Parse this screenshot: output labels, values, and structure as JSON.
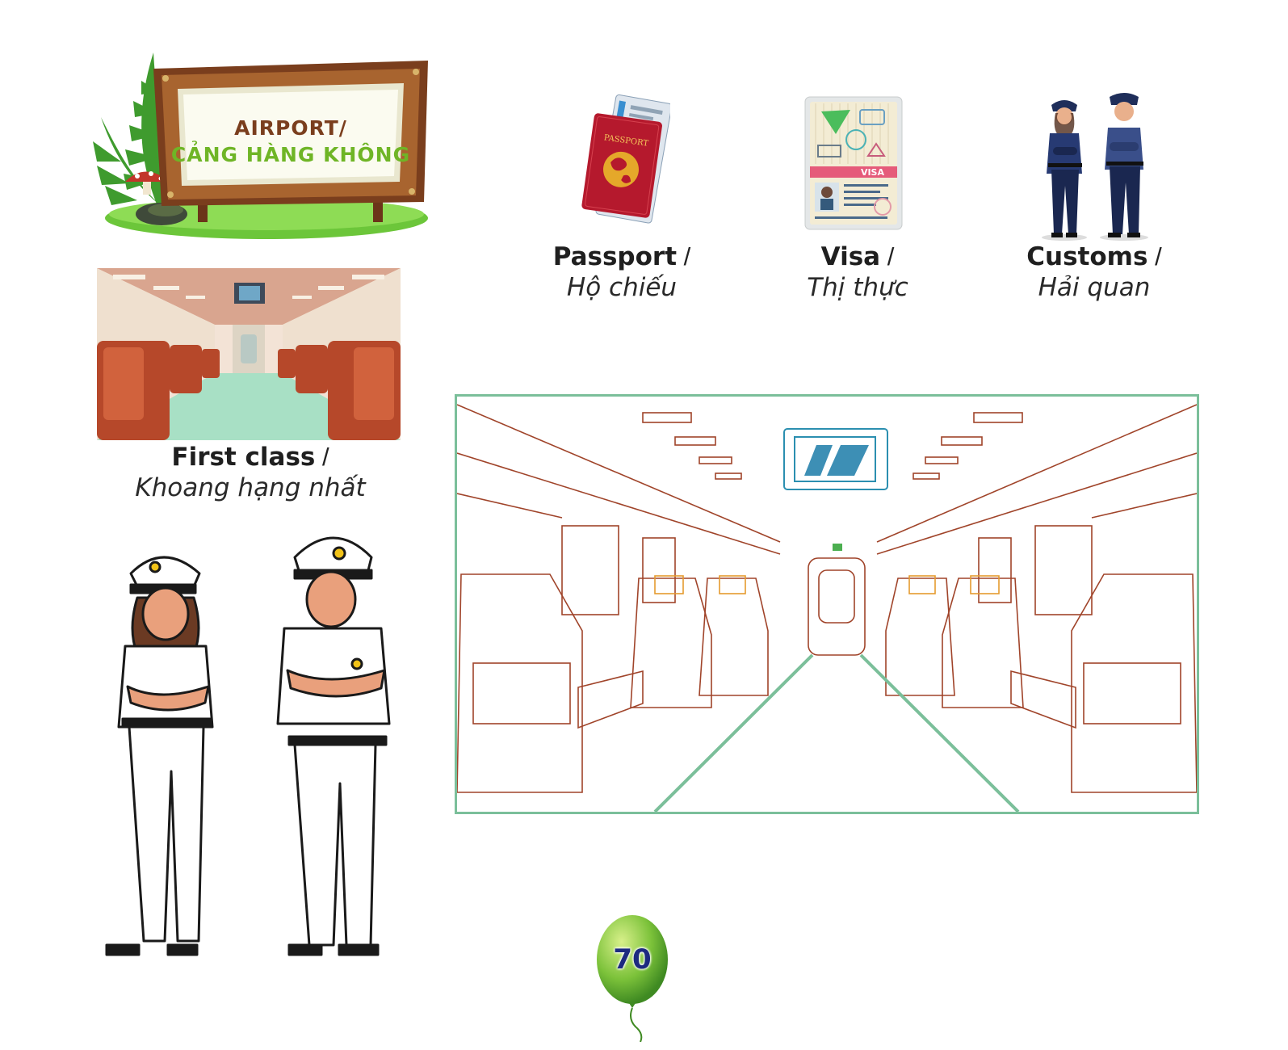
{
  "sign": {
    "line1": "AIRPORT/",
    "line2": "CẢNG HÀNG KHÔNG"
  },
  "vocab": {
    "passport": {
      "en": "Passport",
      "vi": "Hộ chiếu"
    },
    "visa": {
      "en": "Visa",
      "vi": "Thị thực",
      "card_label": "VISA"
    },
    "customs": {
      "en": "Customs",
      "vi": "Hải quan"
    },
    "first_class": {
      "en": "First class",
      "vi": "Khoang hạng nhất"
    }
  },
  "passport_cover_text": "PASSPORT",
  "page_number": "70",
  "icons": [
    "signboard-icon",
    "passport-icon",
    "visa-icon",
    "customs-officers-icon",
    "train-cabin-icon",
    "police-officers-icon",
    "balloon-icon"
  ],
  "colors": {
    "accent_green": "#6fb526",
    "sign_brown": "#7a3e1d",
    "frame_green": "#7bbf9a",
    "passport_red": "#b5192d",
    "balloon_green": "#7cc23a",
    "number_blue": "#1d2a80"
  }
}
